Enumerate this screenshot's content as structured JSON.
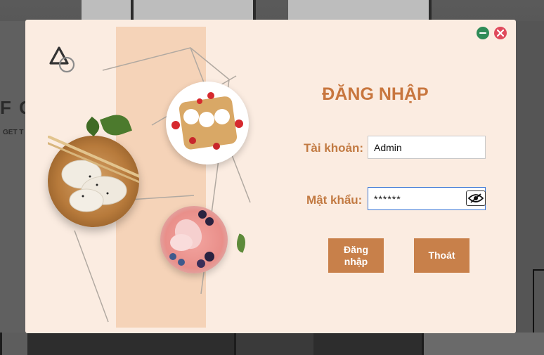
{
  "window": {
    "minimize_icon": "minimize-icon",
    "close_icon": "close-icon",
    "colors": {
      "minimize": "#2e8b57",
      "close": "#e04a5c"
    }
  },
  "background": {
    "ghost_text": "F G",
    "ghost_subtext": "GET T"
  },
  "login": {
    "title": "ĐĂNG NHẬP",
    "username_label": "Tài khoản:",
    "username_value": "Admin",
    "password_label": "Mật khẩu:",
    "password_value": "******",
    "show_password_icon": "eye-slash-icon",
    "login_button": "Đăng nhập",
    "exit_button": "Thoát"
  },
  "colors": {
    "panel_bg": "#fbece1",
    "stripe": "#f5d3b8",
    "accent": "#c8804a",
    "title": "#c8763e"
  },
  "images": [
    "dumplings-bowl",
    "crepes-plate",
    "smoothie-bowl"
  ]
}
